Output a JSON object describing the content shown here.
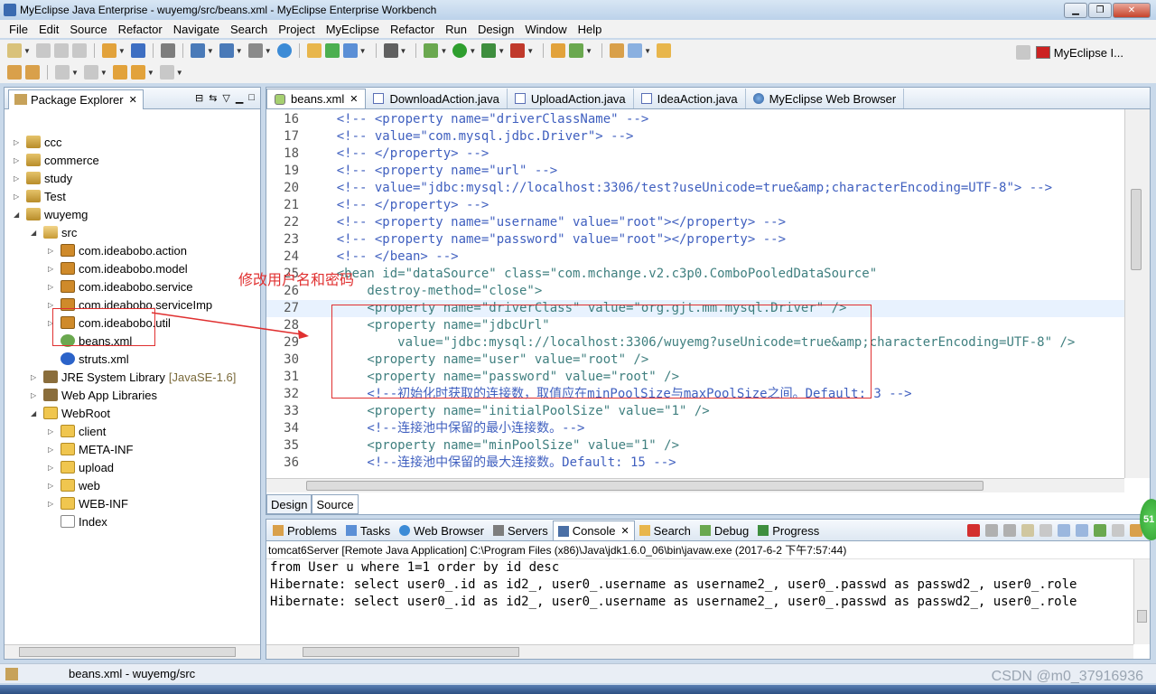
{
  "window": {
    "title": "MyEclipse Java Enterprise - wuyemg/src/beans.xml - MyEclipse Enterprise Workbench"
  },
  "menu": [
    "File",
    "Edit",
    "Source",
    "Refactor",
    "Navigate",
    "Search",
    "Project",
    "MyEclipse",
    "Refactor",
    "Run",
    "Design",
    "Window",
    "Help"
  ],
  "perspective": {
    "label": "MyEclipse I..."
  },
  "package_explorer": {
    "tab_label": "Package Explorer",
    "tree": [
      {
        "label": "ccc",
        "icon": "project-icon",
        "expanded": false
      },
      {
        "label": "commerce",
        "icon": "project-icon",
        "expanded": false
      },
      {
        "label": "study",
        "icon": "project-icon",
        "expanded": false
      },
      {
        "label": "Test",
        "icon": "project-icon",
        "expanded": false
      },
      {
        "label": "wuyemg",
        "icon": "project-icon",
        "expanded": true
      },
      {
        "label": "src",
        "icon": "source-folder-icon",
        "expanded": true
      },
      {
        "label": "com.ideabobo.action",
        "icon": "package-icon"
      },
      {
        "label": "com.ideabobo.model",
        "icon": "package-icon"
      },
      {
        "label": "com.ideabobo.service",
        "icon": "package-icon"
      },
      {
        "label": "com.ideabobo.serviceImp",
        "icon": "package-icon"
      },
      {
        "label": "com.ideabobo.util",
        "icon": "package-icon"
      },
      {
        "label": "beans.xml",
        "icon": "xml-file-icon"
      },
      {
        "label": "struts.xml",
        "icon": "struts-file-icon"
      },
      {
        "label": "JRE System Library",
        "icon": "library-icon",
        "decoration": "[JavaSE-1.6]"
      },
      {
        "label": "Web App Libraries",
        "icon": "library-icon"
      },
      {
        "label": "WebRoot",
        "icon": "folder-icon",
        "expanded": true
      },
      {
        "label": "client",
        "icon": "folder-icon"
      },
      {
        "label": "META-INF",
        "icon": "folder-icon"
      },
      {
        "label": "upload",
        "icon": "folder-icon"
      },
      {
        "label": "web",
        "icon": "folder-icon"
      },
      {
        "label": "WEB-INF",
        "icon": "folder-icon"
      },
      {
        "label": "Index",
        "icon": "file-icon"
      }
    ]
  },
  "editor": {
    "tabs": [
      {
        "label": "beans.xml",
        "active": true
      },
      {
        "label": "DownloadAction.java"
      },
      {
        "label": "UploadAction.java"
      },
      {
        "label": "IdeaAction.java"
      },
      {
        "label": "MyEclipse Web Browser"
      }
    ],
    "lines": [
      {
        "no": "16",
        "text": "    <!-- <property name=\"driverClassName\" -->",
        "style": "comment"
      },
      {
        "no": "17",
        "text": "    <!-- value=\"com.mysql.jdbc.Driver\"> -->",
        "style": "comment"
      },
      {
        "no": "18",
        "text": "    <!-- </property> -->",
        "style": "comment"
      },
      {
        "no": "19",
        "text": "    <!-- <property name=\"url\" -->",
        "style": "comment"
      },
      {
        "no": "20",
        "text": "    <!-- value=\"jdbc:mysql://localhost:3306/test?useUnicode=true&amp;characterEncoding=UTF-8\"> -->",
        "style": "comment"
      },
      {
        "no": "21",
        "text": "    <!-- </property> -->",
        "style": "comment"
      },
      {
        "no": "22",
        "text": "    <!-- <property name=\"username\" value=\"root\"></property> -->",
        "style": "comment"
      },
      {
        "no": "23",
        "text": "    <!-- <property name=\"password\" value=\"root\"></property> -->",
        "style": "comment"
      },
      {
        "no": "24",
        "text": "    <!-- </bean> -->",
        "style": "comment"
      },
      {
        "no": "25",
        "text": "    <bean id=\"dataSource\" class=\"com.mchange.v2.c3p0.ComboPooledDataSource\"",
        "style": "code"
      },
      {
        "no": "26",
        "text": "        destroy-method=\"close\">",
        "style": "code"
      },
      {
        "no": "27",
        "text": "        <property name=\"driverClass\" value=\"org.gjt.mm.mysql.Driver\" />",
        "style": "code",
        "highlight": true
      },
      {
        "no": "28",
        "text": "        <property name=\"jdbcUrl\"",
        "style": "code"
      },
      {
        "no": "29",
        "text": "            value=\"jdbc:mysql://localhost:3306/wuyemg?useUnicode=true&amp;characterEncoding=UTF-8\" />",
        "style": "code"
      },
      {
        "no": "30",
        "text": "        <property name=\"user\" value=\"root\" />",
        "style": "code"
      },
      {
        "no": "31",
        "text": "        <property name=\"password\" value=\"root\" />",
        "style": "code"
      },
      {
        "no": "32",
        "text": "        <!--初始化时获取的连接数，取值应在minPoolSize与maxPoolSize之间。Default: 3 -->",
        "style": "comment"
      },
      {
        "no": "33",
        "text": "        <property name=\"initialPoolSize\" value=\"1\" />",
        "style": "code"
      },
      {
        "no": "34",
        "text": "        <!--连接池中保留的最小连接数。-->",
        "style": "comment"
      },
      {
        "no": "35",
        "text": "        <property name=\"minPoolSize\" value=\"1\" />",
        "style": "code"
      },
      {
        "no": "36",
        "text": "        <!--连接池中保留的最大连接数。Default: 15 -->",
        "style": "comment"
      }
    ],
    "bottom_tabs": [
      "Design",
      "Source"
    ],
    "annotation": "修改用户名和密码"
  },
  "console": {
    "tabs": [
      "Problems",
      "Tasks",
      "Web Browser",
      "Servers",
      "Console",
      "Search",
      "Debug",
      "Progress"
    ],
    "active_tab": "Console",
    "description": "tomcat6Server [Remote Java Application] C:\\Program Files (x86)\\Java\\jdk1.6.0_06\\bin\\javaw.exe (2017-6-2 下午7:57:44)",
    "output": [
      "from User u where 1=1 order by id desc",
      "Hibernate: select user0_.id as id2_, user0_.username as username2_, user0_.passwd as passwd2_, user0_.role",
      "Hibernate: select user0_.id as id2_, user0_.username as username2_, user0_.passwd as passwd2_, user0_.role"
    ]
  },
  "status": {
    "text": "beans.xml - wuyemg/src"
  },
  "watermark": "CSDN @m0_37916936",
  "badge": "51",
  "colors": {
    "annotation": "#e03030",
    "comment": "#3f5fbf",
    "value": "#2a00ff",
    "attribute": "#7f007f"
  }
}
